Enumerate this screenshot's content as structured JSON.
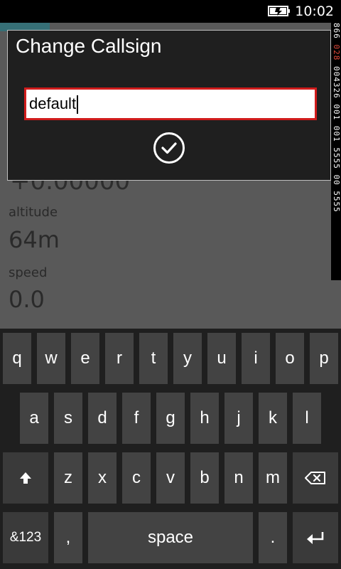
{
  "status_bar": {
    "time": "10:02",
    "battery_icon": "battery-charging-icon"
  },
  "background": {
    "coordinate_partial": "+0.00000",
    "altitude_label": "altitude",
    "altitude_value": "64m",
    "speed_label": "speed",
    "speed_value": "0.0"
  },
  "side_ticker": {
    "text_part1": "866  ",
    "text_red": "028",
    "text_part2": "  004326 001 001  5555 00 5555"
  },
  "dialog": {
    "title": "Change Callsign",
    "input_value": "default",
    "confirm_icon": "checkmark-icon"
  },
  "keyboard": {
    "row1": [
      "q",
      "w",
      "e",
      "r",
      "t",
      "y",
      "u",
      "i",
      "o",
      "p"
    ],
    "row2": [
      "a",
      "s",
      "d",
      "f",
      "g",
      "h",
      "j",
      "k",
      "l"
    ],
    "row3": [
      "z",
      "x",
      "c",
      "v",
      "b",
      "n",
      "m"
    ],
    "shift_icon": "shift-arrow-icon",
    "backspace_icon": "backspace-icon",
    "symbols_label": "&123",
    "comma_label": ",",
    "space_label": "space",
    "period_label": ".",
    "enter_icon": "enter-icon"
  },
  "colors": {
    "accent": "#1f7f8a",
    "input_border": "#d01c1c"
  }
}
